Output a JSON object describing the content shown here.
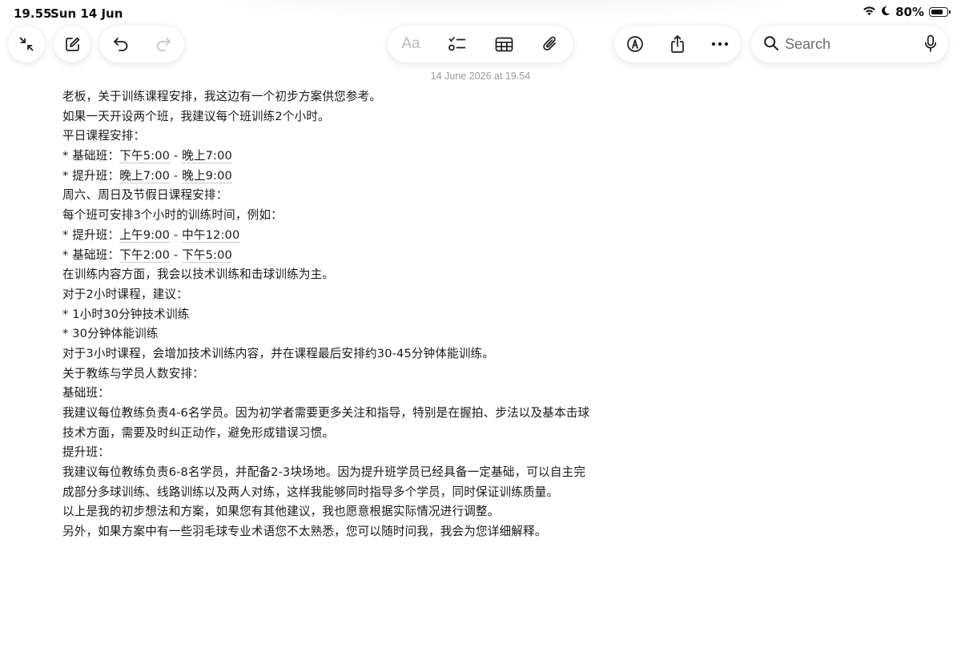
{
  "status_bar": {
    "time": "19.55",
    "date": "Sun 14 Jun",
    "battery_percent": "80%",
    "battery_level": 0.8
  },
  "toolbar": {
    "left_buttons": [
      "collapse-icon",
      "compose-icon"
    ],
    "history_buttons": [
      "undo-icon",
      "redo-icon"
    ],
    "format_label": "Aa",
    "format_buttons": [
      "checklist-icon",
      "table-icon",
      "attachment-icon"
    ],
    "action_buttons": [
      "markup-icon",
      "share-icon",
      "more-icon"
    ]
  },
  "search": {
    "placeholder": "Search"
  },
  "note": {
    "timestamp": "14 June 2026 at 19.54",
    "lines": [
      {
        "text": "老板，关于训练课程安排，我这边有一个初步方案供您参考。"
      },
      {
        "text": "如果一天开设两个班，我建议每个班训练2个小时。"
      },
      {
        "text": "平日课程安排："
      },
      {
        "prefix": "* 基础班：",
        "time1": "下午5:00",
        "sep": " - ",
        "time2": "晚上7:00"
      },
      {
        "prefix": "* 提升班：",
        "time1": "晚上7:00",
        "sep": " - ",
        "time2": "晚上9:00"
      },
      {
        "text": "周六、周日及节假日课程安排："
      },
      {
        "text": "每个班可安排3个小时的训练时间，例如："
      },
      {
        "prefix": "* 提升班：",
        "time1": "上午9:00",
        "sep": " - ",
        "time2": "中午12:00"
      },
      {
        "prefix": "* 基础班：",
        "time1": "下午2:00",
        "sep": " - ",
        "time2": "下午5:00"
      },
      {
        "text": "在训练内容方面，我会以技术训练和击球训练为主。"
      },
      {
        "text": "对于2小时课程，建议："
      },
      {
        "text": "* 1小时30分钟技术训练"
      },
      {
        "text": "* 30分钟体能训练"
      },
      {
        "text": "对于3小时课程，会增加技术训练内容，并在课程最后安排约30-45分钟体能训练。"
      },
      {
        "text": "关于教练与学员人数安排："
      },
      {
        "text": "基础班："
      },
      {
        "text": "我建议每位教练负责4-6名学员。因为初学者需要更多关注和指导，特别是在握拍、步法以及基本击球"
      },
      {
        "text": "技术方面，需要及时纠正动作，避免形成错误习惯。"
      },
      {
        "text": "提升班："
      },
      {
        "text": "我建议每位教练负责6-8名学员，并配备2-3块场地。因为提升班学员已经具备一定基础，可以自主完"
      },
      {
        "text": "成部分多球训练、线路训练以及两人对练，这样我能够同时指导多个学员，同时保证训练质量。"
      },
      {
        "text": "以上是我的初步想法和方案，如果您有其他建议，我也愿意根据实际情况进行调整。"
      },
      {
        "text": "另外，如果方案中有一些羽毛球专业术语您不太熟悉，您可以随时问我，我会为您详细解释。"
      }
    ]
  }
}
